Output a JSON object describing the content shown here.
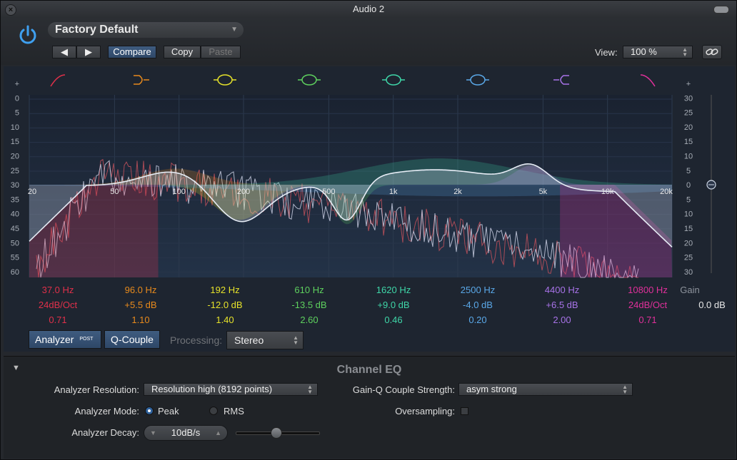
{
  "window": {
    "title": "Audio 2"
  },
  "header": {
    "preset": "Factory Default",
    "compare_label": "Compare",
    "copy_label": "Copy",
    "paste_label": "Paste",
    "view_label": "View:",
    "view_value": "100 %"
  },
  "colors": {
    "band_colors": [
      "#e0304a",
      "#e88a1c",
      "#e6e22a",
      "#5ed15e",
      "#3fd6a8",
      "#5aa8e8",
      "#a873e8",
      "#e0309a"
    ],
    "gain_text": "#aab0ba",
    "gain_value": "#e8e8e8"
  },
  "icons": [
    "power-icon",
    "close-icon",
    "link-icon",
    "chevron-left-icon",
    "chevron-right-icon",
    "disclosure-triangle-icon"
  ],
  "eq": {
    "left_scale": [
      "+",
      "0",
      "5",
      "10",
      "15",
      "20",
      "25",
      "30",
      "35",
      "40",
      "45",
      "50",
      "55",
      "60",
      "-"
    ],
    "right_scale": [
      "+",
      "30",
      "25",
      "20",
      "15",
      "10",
      "5",
      "0",
      "5",
      "10",
      "15",
      "20",
      "25",
      "30",
      "-"
    ],
    "freq_axis": [
      "20",
      "50",
      "100",
      "200",
      "500",
      "1k",
      "2k",
      "5k",
      "10k",
      "20k"
    ],
    "bands": [
      {
        "freq": "37.0 Hz",
        "gain": "24dB/Oct",
        "q": "0.71"
      },
      {
        "freq": "96.0 Hz",
        "gain": "+5.5 dB",
        "q": "1.10"
      },
      {
        "freq": "192 Hz",
        "gain": "-12.0 dB",
        "q": "1.40"
      },
      {
        "freq": "610 Hz",
        "gain": "-13.5 dB",
        "q": "2.60"
      },
      {
        "freq": "1620 Hz",
        "gain": "+9.0 dB",
        "q": "0.46"
      },
      {
        "freq": "2500 Hz",
        "gain": "-4.0 dB",
        "q": "0.20"
      },
      {
        "freq": "4400 Hz",
        "gain": "+6.5 dB",
        "q": "2.00"
      },
      {
        "freq": "10800 Hz",
        "gain": "24dB/Oct",
        "q": "0.71"
      }
    ],
    "gain_label": "Gain",
    "gain_value": "0.0 dB"
  },
  "lower": {
    "analyzer_label": "Analyzer",
    "analyzer_badge": "POST",
    "qcouple_label": "Q-Couple",
    "processing_label": "Processing:",
    "processing_value": "Stereo"
  },
  "panel": {
    "title": "Channel EQ",
    "analyzer_resolution_label": "Analyzer Resolution:",
    "analyzer_resolution_value": "Resolution high (8192 points)",
    "gain_q_label": "Gain-Q Couple Strength:",
    "gain_q_value": "asym strong",
    "analyzer_mode_label": "Analyzer Mode:",
    "mode_peak": "Peak",
    "mode_rms": "RMS",
    "oversampling_label": "Oversampling:",
    "analyzer_decay_label": "Analyzer Decay:",
    "analyzer_decay_value": "10dB/s"
  }
}
